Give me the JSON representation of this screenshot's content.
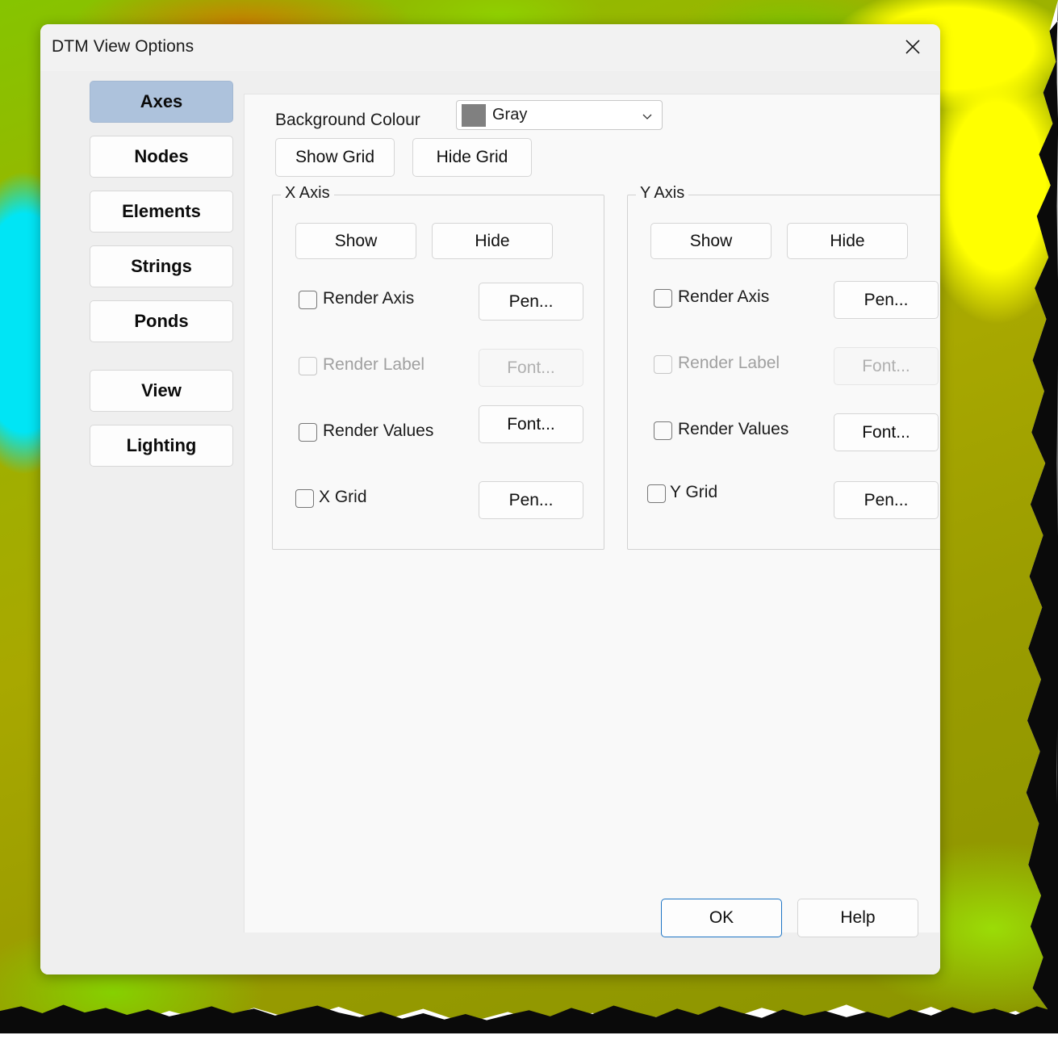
{
  "window": {
    "title": "DTM View Options",
    "close_icon": "close-icon"
  },
  "sidebar": {
    "items": [
      {
        "label": "Axes",
        "active": true
      },
      {
        "label": "Nodes",
        "active": false
      },
      {
        "label": "Elements",
        "active": false
      },
      {
        "label": "Strings",
        "active": false
      },
      {
        "label": "Ponds",
        "active": false
      },
      {
        "label": "View",
        "active": false
      },
      {
        "label": "Lighting",
        "active": false
      }
    ]
  },
  "main": {
    "background_colour": {
      "label": "Background Colour",
      "value": "Gray",
      "swatch_hex": "#808080",
      "chevron_icon": "chevron-down-icon"
    },
    "grid_buttons": {
      "show": "Show Grid",
      "hide": "Hide Grid"
    },
    "x_axis": {
      "title": "X Axis",
      "show": "Show",
      "hide": "Hide",
      "rows": [
        {
          "label": "Render Axis",
          "button": "Pen...",
          "checked": false,
          "disabled": false
        },
        {
          "label": "Render Label",
          "button": "Font...",
          "checked": false,
          "disabled": true
        },
        {
          "label": "Render Values",
          "button": "Font...",
          "checked": false,
          "disabled": false
        },
        {
          "label": "X Grid",
          "button": "Pen...",
          "checked": false,
          "disabled": false
        }
      ]
    },
    "y_axis": {
      "title": "Y Axis",
      "show": "Show",
      "hide": "Hide",
      "rows": [
        {
          "label": "Render Axis",
          "button": "Pen...",
          "checked": false,
          "disabled": false
        },
        {
          "label": "Render Label",
          "button": "Font...",
          "checked": false,
          "disabled": true
        },
        {
          "label": "Render Values",
          "button": "Font...",
          "checked": false,
          "disabled": false
        },
        {
          "label": "Y Grid",
          "button": "Pen...",
          "checked": false,
          "disabled": false
        }
      ]
    }
  },
  "footer": {
    "ok": "OK",
    "help": "Help"
  },
  "colors": {
    "accent": "#1d74c4",
    "sidebar_active": "#adc2dc",
    "dialog_bg": "#efefef",
    "panel_bg": "#f9f9f9"
  }
}
